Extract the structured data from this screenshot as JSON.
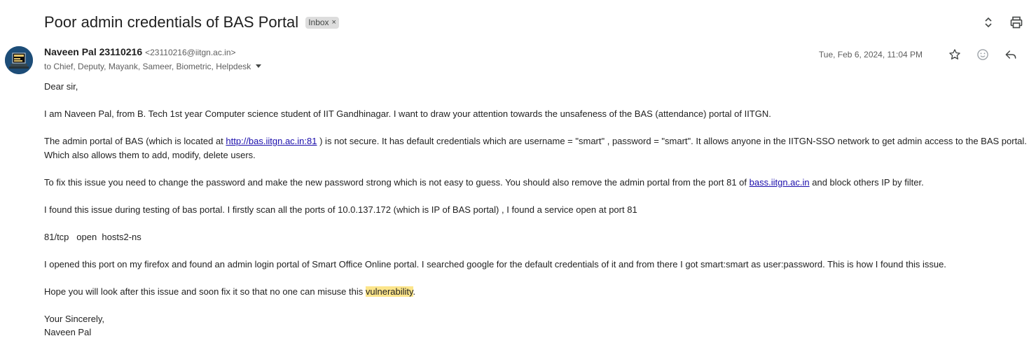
{
  "email": {
    "subject": "Poor admin credentials of BAS Portal",
    "label": "Inbox",
    "label_remove": "×",
    "sender_name": "Naveen Pal 23110216",
    "sender_email": "<23110216@iitgn.ac.in>",
    "recipients": "to Chief, Deputy, Mayank, Sameer, Biometric, Helpdesk",
    "date": "Tue, Feb 6, 2024, 11:04 PM",
    "icons": {
      "expand": "unfold-icon",
      "print": "print-icon",
      "star": "star-icon",
      "emoji": "emoji-icon",
      "reply": "reply-icon",
      "caret": "caret-down-icon"
    },
    "body": {
      "greeting": "Dear sir,",
      "p1": "I am Naveen Pal, from B. Tech 1st year Computer science student of IIT Gandhinagar. I want to draw your attention towards the unsafeness of the BAS (attendance) portal of IITGN.",
      "p2_before": "The admin portal of BAS (which is located at ",
      "p2_link": "http://bas.iitgn.ac.in:81",
      "p2_after": " ) is not secure. It has default credentials which are username = \"smart\" , password = \"smart\". It allows anyone in the IITGN-SSO network to get admin access to the BAS portal. Which also allows them to add, modify, delete users.",
      "p3_before": "To fix this issue you need to change the password and make the new password strong which is not easy to guess. You should also remove the admin portal from the port 81 of ",
      "p3_link": "bass.iitgn.ac.in",
      "p3_after": " and block others IP by filter.",
      "p4": "I found this issue during testing of bas portal. I firstly scan all the ports of 10.0.137.172 (which is IP of BAS portal) , I found a service open at port 81",
      "p5": "81/tcp   open  hosts2-ns",
      "p6": "I opened this port on my firefox and found an admin login portal of Smart Office Online portal. I searched google for the default credentials of it and from there I got smart:smart as user:password. This is how I found this issue.",
      "p7_before": "Hope you will look after this issue and soon fix it so that no one can misuse this ",
      "p7_highlight": "vulnerability",
      "p7_after": ".",
      "closing": "Your Sincerely,",
      "signature": "Naveen Pal"
    }
  }
}
